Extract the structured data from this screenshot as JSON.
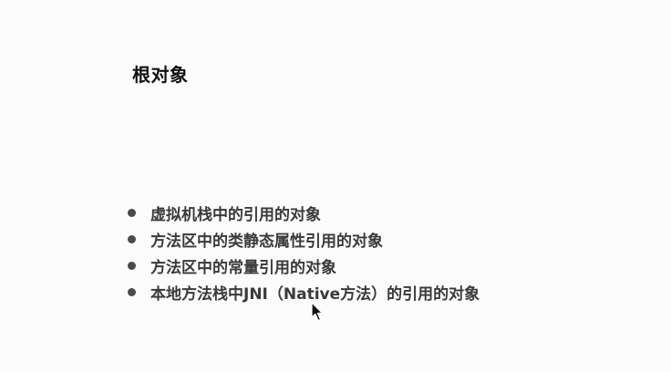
{
  "slide": {
    "title": "根对象",
    "bullets": [
      "虚拟机栈中的引用的对象",
      "方法区中的类静态属性引用的对象",
      "方法区中的常量引用的对象",
      "本地方法栈中JNI（Native方法）的引用的对象"
    ]
  },
  "colors": {
    "background": "#fcfcfc",
    "title": "#111111",
    "bullet_text": "#3a3a3a",
    "bullet_dot": "#4a4a4a"
  },
  "cursor": {
    "icon": "mouse-pointer-icon"
  }
}
